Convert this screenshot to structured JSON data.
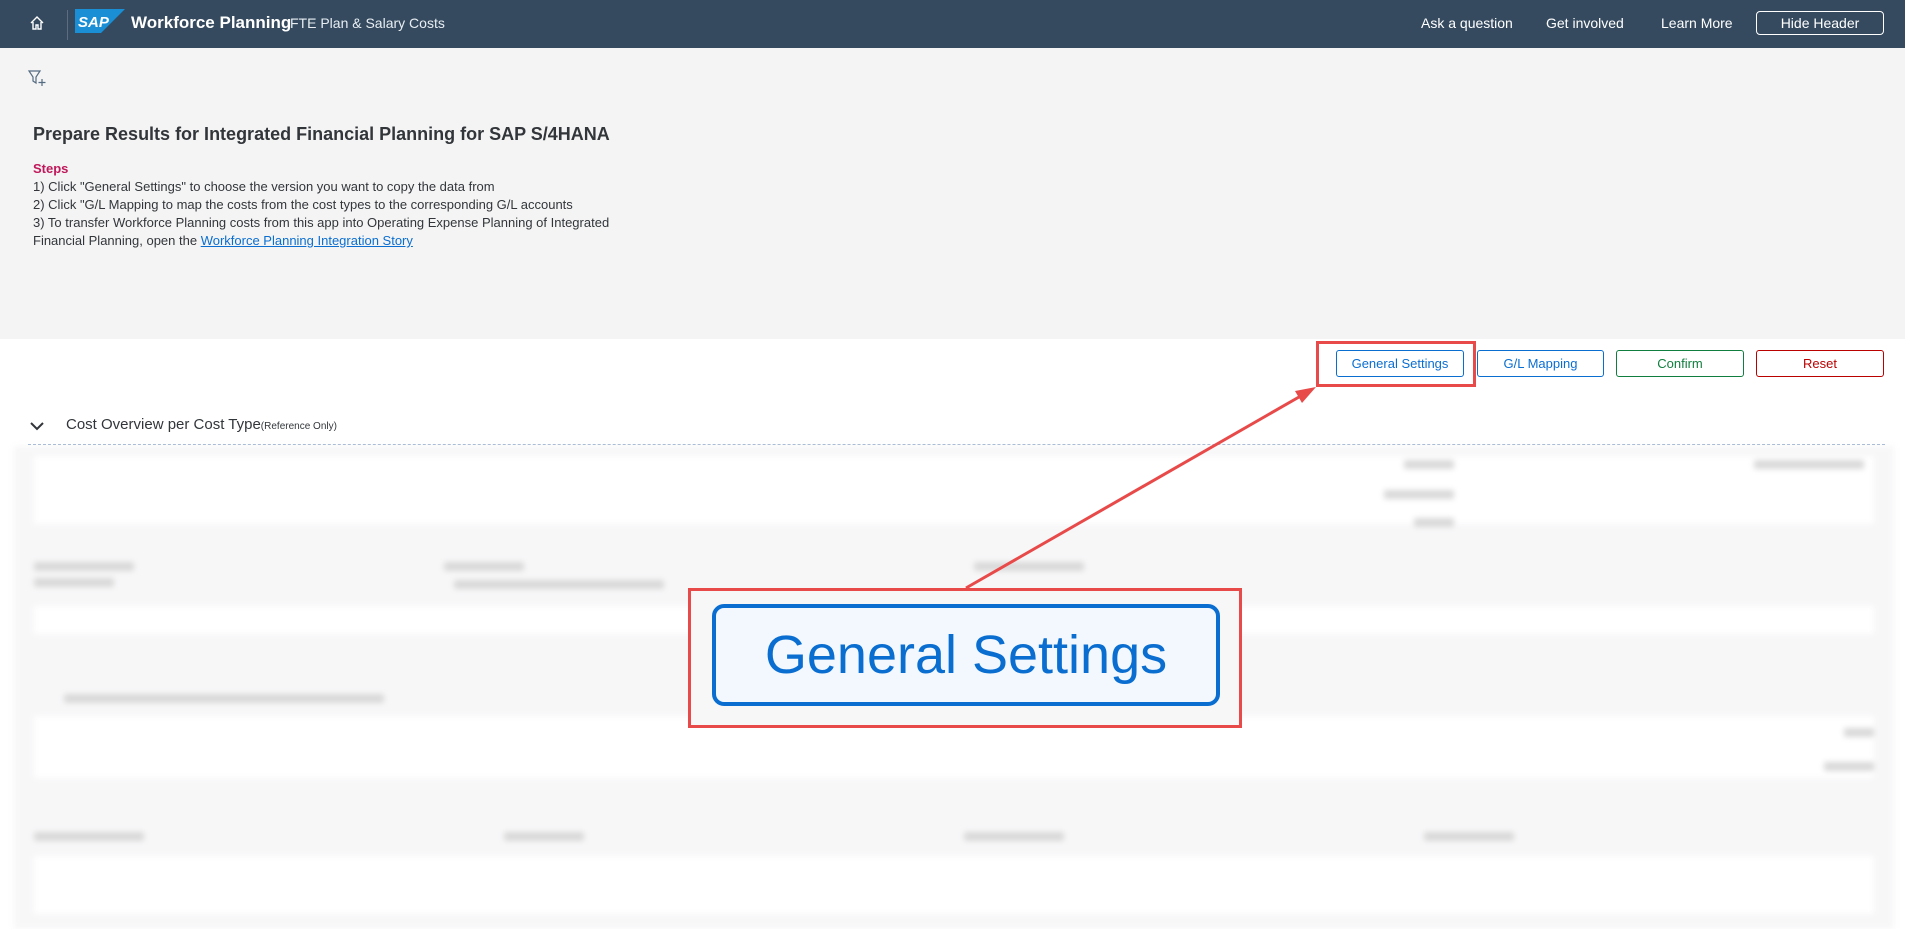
{
  "shell": {
    "logo_text": "SAP",
    "app_title": "Workforce Planning",
    "app_subtitle": "FTE Plan & Salary Costs",
    "links": {
      "ask": "Ask a question",
      "involved": "Get involved",
      "learn": "Learn More"
    },
    "hide_header": "Hide Header",
    "icons": {
      "home": "home-icon",
      "filter": "filter-add-icon"
    }
  },
  "page": {
    "title": "Prepare Results for Integrated Financial Planning for SAP S/4HANA",
    "steps_label": "Steps",
    "step1": "1) Click \"General Settings\" to choose the version you want to copy the data from",
    "step2": "2) Click \"G/L Mapping to map the costs from the cost types to the corresponding G/L accounts",
    "step3": "3) To transfer Workforce Planning costs from this app into Operating Expense Planning of Integrated",
    "step4_prefix": "Financial Planning, open the ",
    "step4_link": "Workforce Planning Integration Story"
  },
  "actions": {
    "general_settings": "General Settings",
    "gl_mapping": "G/L Mapping",
    "confirm": "Confirm",
    "reset": "Reset"
  },
  "section": {
    "title": "Cost Overview per Cost Type",
    "note": "(Reference Only)"
  },
  "callout": {
    "label": "General Settings"
  },
  "colors": {
    "shell_bg": "#354a5f",
    "accent": "#0a6ed1",
    "confirm": "#107e3e",
    "reset": "#bb0000",
    "steps": "#c0185a",
    "highlight": "#e84a4a"
  }
}
